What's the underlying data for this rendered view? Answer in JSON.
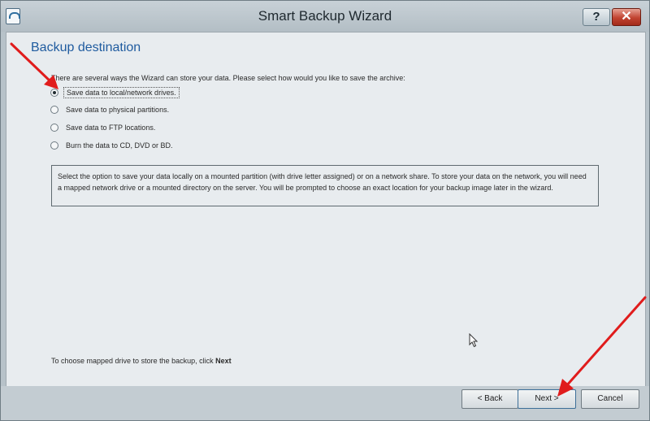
{
  "window": {
    "title": "Smart Backup Wizard",
    "help_label": "?",
    "close_label": "✕"
  },
  "page": {
    "heading": "Backup destination",
    "prompt": "There are several ways the Wizard can store your data. Please select how would you like to save the archive:",
    "options": [
      {
        "label": "Save data to local/network drives.",
        "checked": true
      },
      {
        "label": "Save data to physical partitions.",
        "checked": false
      },
      {
        "label": "Save data to FTP locations.",
        "checked": false
      },
      {
        "label": "Burn the data to CD, DVD or BD.",
        "checked": false
      }
    ],
    "description": "Select the option to save your data locally on a mounted partition (with drive letter assigned) or on a network share. To store your data on the network, you will need a mapped network drive or a mounted directory on the server. You will be prompted to choose an exact location for your backup image later in the wizard.",
    "footer_text": "To choose mapped drive to store the backup, click",
    "footer_bold": "Next"
  },
  "buttons": {
    "back": "< Back",
    "next": "Next >",
    "cancel": "Cancel"
  },
  "colors": {
    "heading": "#1f5b9f",
    "annotation_arrow": "#e01c1c",
    "close_button": "#c14330"
  }
}
